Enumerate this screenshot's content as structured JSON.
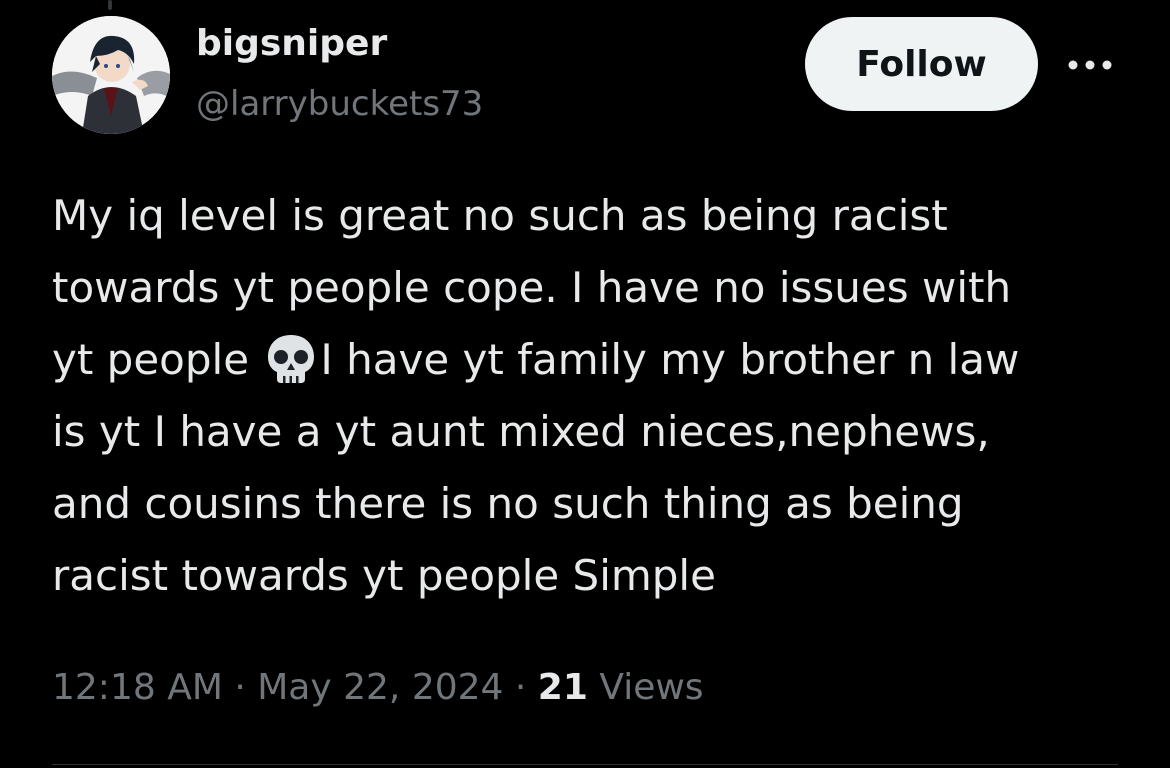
{
  "user": {
    "display_name": "bigsniper",
    "handle": "@larrybuckets73"
  },
  "actions": {
    "follow_label": "Follow",
    "more_icon": "more-horizontal-icon"
  },
  "tweet": {
    "lines": [
      "My iq level is great no such as being racist",
      "towards yt people cope. I have no issues with",
      "yt people",
      "I have yt family my brother n law",
      "is yt I have a yt aunt mixed nieces,nephews,",
      "and cousins there is no such thing as being",
      "racist towards yt people Simple"
    ],
    "emoji": "skull-emoji"
  },
  "meta": {
    "time": "12:18 AM",
    "separator": "·",
    "date": "May 22, 2024",
    "views_count": "21",
    "views_label": "Views"
  },
  "colors": {
    "background": "#000000",
    "primary_text": "#e7e9ea",
    "secondary_text": "#71767b",
    "follow_bg": "#eff3f4",
    "follow_text": "#0f1419"
  }
}
